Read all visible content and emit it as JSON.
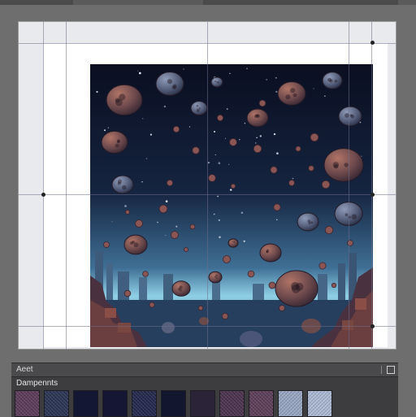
{
  "panel": {
    "title": "Aeet",
    "subtitle": "Dampennts"
  },
  "colors": {
    "sky_top": "#0b0f22",
    "sky_mid": "#1b2b47",
    "sky_horizon": "#8fd0e6",
    "asteroid": "#6b4a4c",
    "asteroid_highlight": "#a06a5e",
    "rock": "#4a3140",
    "city": "#3d5a7a"
  },
  "swatches": [
    {
      "name": "swatch-purple-noise",
      "color": "#5e3d5c",
      "pattern": "noise"
    },
    {
      "name": "swatch-navy-noise",
      "color": "#2c3656",
      "pattern": "noise"
    },
    {
      "name": "swatch-deep-navy",
      "color": "#131734",
      "pattern": "solid"
    },
    {
      "name": "swatch-deep-indigo",
      "color": "#151634",
      "pattern": "solid"
    },
    {
      "name": "swatch-indigo-noise",
      "color": "#242a4e",
      "pattern": "noise"
    },
    {
      "name": "swatch-dark-navy",
      "color": "#12162e",
      "pattern": "solid"
    },
    {
      "name": "swatch-dark-plum",
      "color": "#2b2438",
      "pattern": "solid"
    },
    {
      "name": "swatch-plum-noise",
      "color": "#4d3450",
      "pattern": "noise"
    },
    {
      "name": "swatch-mauve-noise",
      "color": "#5f3f5a",
      "pattern": "noise"
    },
    {
      "name": "swatch-light-slate-noise",
      "color": "#9aa8c4",
      "pattern": "noise"
    },
    {
      "name": "swatch-pale-blue-noise",
      "color": "#aebbd6",
      "pattern": "noise"
    }
  ]
}
